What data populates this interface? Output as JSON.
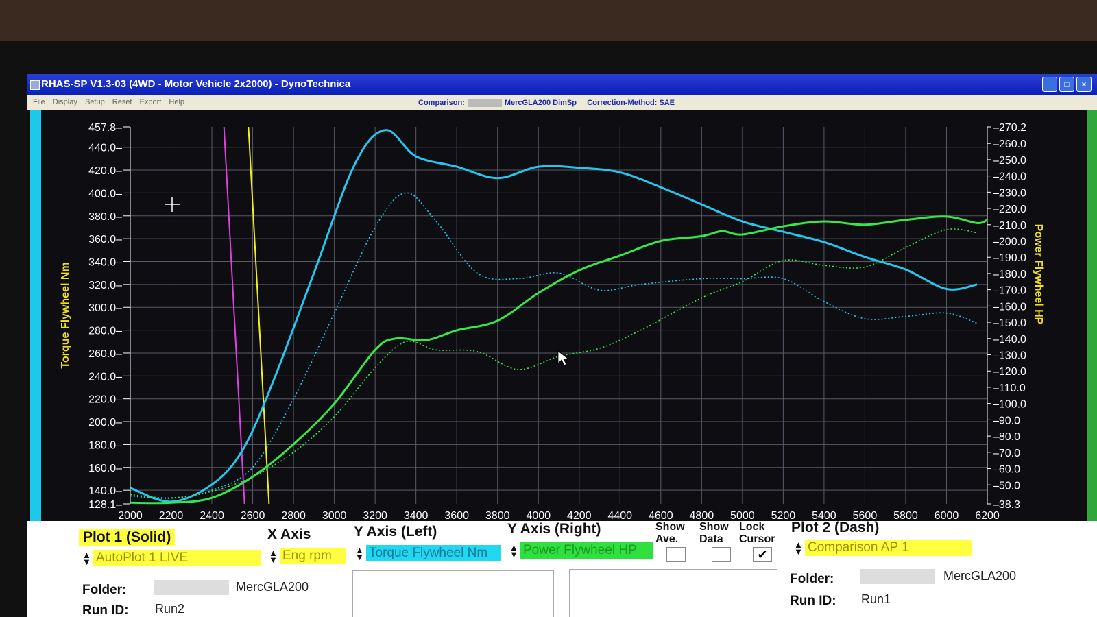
{
  "window": {
    "title": "RHAS-SP V1.3-03  (4WD - Motor Vehicle 2x2000) - DynoTechnica",
    "menu": [
      "File",
      "Display",
      "Setup",
      "Reset",
      "Export",
      "Help"
    ]
  },
  "infobar": {
    "comparison_label": "Comparison:",
    "comparison_value": "MercGLA200 DimSp",
    "correction": "Correction-Method: SAE"
  },
  "chart_data": {
    "type": "line",
    "xlabel": "",
    "ylabel_left": "Torque Flywheel Nm",
    "ylabel_right": "Power Flywheel HP",
    "x_ticks": [
      "2000",
      "2200",
      "2400",
      "2600",
      "2800",
      "3000",
      "3200",
      "3400",
      "3600",
      "3800",
      "4000",
      "4200",
      "4400",
      "4600",
      "4800",
      "5000",
      "5200",
      "5400",
      "5600",
      "5800",
      "6000",
      "6200"
    ],
    "y_left_ticks": [
      "457.8",
      "440.0",
      "420.0",
      "400.0",
      "380.0",
      "360.0",
      "340.0",
      "320.0",
      "300.0",
      "280.0",
      "260.0",
      "240.0",
      "220.0",
      "200.0",
      "180.0",
      "160.0",
      "140.0",
      "128.1"
    ],
    "y_right_ticks": [
      "270.2",
      "260.0",
      "250.0",
      "240.0",
      "230.0",
      "220.0",
      "210.0",
      "200.0",
      "190.0",
      "180.0",
      "170.0",
      "160.0",
      "150.0",
      "140.0",
      "130.0",
      "120.0",
      "110.0",
      "100.0",
      "90.0",
      "80.0",
      "70.0",
      "60.0",
      "50.0",
      "38.3"
    ],
    "xlim": [
      2000,
      6200
    ],
    "ylim_left": [
      128.1,
      457.8
    ],
    "ylim_right": [
      38.3,
      270.2
    ],
    "grid": true,
    "markers": [
      {
        "x": 2560,
        "color": "#e040e0"
      },
      {
        "x": 2680,
        "color": "#f0f020"
      }
    ],
    "series": [
      {
        "axis": "left",
        "style": "solid",
        "color": "#22c8f0",
        "x": [
          2000,
          2200,
          2400,
          2550,
          2700,
          2900,
          3100,
          3250,
          3400,
          3600,
          3800,
          4000,
          4200,
          4400,
          4600,
          4800,
          5000,
          5200,
          5400,
          5600,
          5800,
          6000,
          6150
        ],
        "y": [
          142,
          130,
          145,
          175,
          235,
          330,
          425,
          455,
          432,
          423,
          413,
          423,
          422,
          418,
          405,
          390,
          375,
          366,
          357,
          344,
          333,
          316,
          320
        ]
      },
      {
        "axis": "left",
        "style": "dotted",
        "color": "#22c8f0",
        "x": [
          2000,
          2200,
          2400,
          2600,
          2800,
          3000,
          3200,
          3350,
          3500,
          3700,
          3900,
          4100,
          4300,
          4500,
          4800,
          5000,
          5200,
          5400,
          5600,
          5800,
          6000,
          6150
        ],
        "y": [
          135,
          133,
          140,
          160,
          220,
          295,
          370,
          400,
          375,
          330,
          325,
          330,
          315,
          320,
          325,
          325,
          325,
          305,
          290,
          292,
          295,
          286
        ]
      },
      {
        "axis": "right",
        "style": "solid",
        "color": "#34e84a",
        "x": [
          2000,
          2200,
          2400,
          2600,
          2800,
          3000,
          3200,
          3300,
          3450,
          3600,
          3800,
          4000,
          4200,
          4400,
          4600,
          4800,
          4900,
          5000,
          5200,
          5400,
          5600,
          5800,
          6000,
          6150,
          6200
        ],
        "y": [
          39,
          39,
          42,
          55,
          75,
          100,
          133,
          140,
          139,
          145,
          151,
          168,
          182,
          191,
          200,
          203,
          206,
          204,
          209,
          212,
          210,
          213,
          215,
          211,
          213
        ]
      },
      {
        "axis": "right",
        "style": "dotted",
        "color": "#34e84a",
        "x": [
          2000,
          2200,
          2400,
          2600,
          2800,
          3000,
          3200,
          3350,
          3500,
          3700,
          3900,
          4100,
          4300,
          4500,
          4800,
          5000,
          5200,
          5400,
          5600,
          5800,
          6000,
          6150
        ],
        "y": [
          44,
          42,
          46,
          55,
          70,
          92,
          122,
          138,
          133,
          132,
          121,
          129,
          134,
          145,
          165,
          175,
          188,
          185,
          184,
          196,
          207,
          205
        ]
      }
    ]
  },
  "controls": {
    "plot1_title": "Plot 1 (Solid)",
    "plot1_value": "AutoPlot 1 LIVE",
    "x_axis_title": "X Axis",
    "x_axis_value": "Eng rpm",
    "y_left_title": "Y Axis (Left)",
    "y_left_value": "Torque Flywheel Nm",
    "y_right_title": "Y Axis (Right)",
    "y_right_value": "Power Flywheel HP",
    "show_ave": "Show Ave.",
    "show_data": "Show Data",
    "lock_cursor": "Lock Cursor",
    "lock_cursor_checked": true,
    "plot2_title": "Plot 2 (Dash)",
    "plot2_value": "Comparison AP 1",
    "folder_label": "Folder:",
    "folder1_value": "MercGLA200",
    "folder2_label": "Folder:",
    "folder2_value": "MercGLA200",
    "runid_label": "Run ID:",
    "runid1_value": "Run2",
    "runid2_label": "Run ID:",
    "runid2_value": "Run1"
  }
}
